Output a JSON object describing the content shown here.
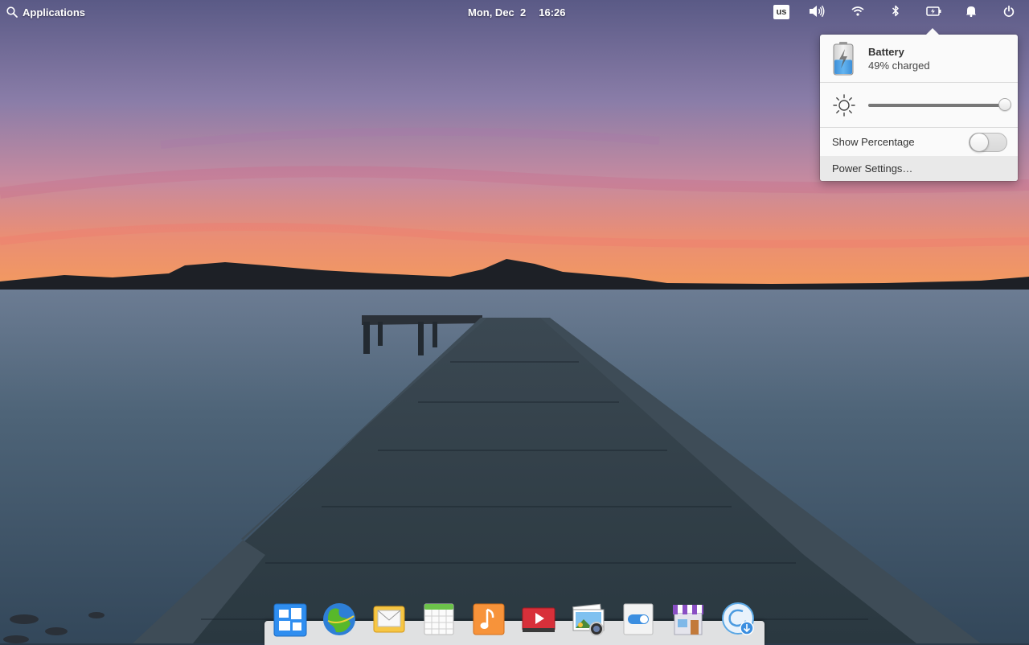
{
  "panel": {
    "applications_label": "Applications",
    "date": "Mon, Dec  2",
    "time": "16:26",
    "keyboard_layout": "us"
  },
  "power_popover": {
    "battery_title": "Battery",
    "battery_status": "49% charged",
    "battery_level": 0.49,
    "brightness_level": 1.0,
    "show_percentage_label": "Show Percentage",
    "show_percentage_enabled": false,
    "power_settings_label": "Power Settings…"
  },
  "dock": {
    "items": [
      {
        "name": "multitasking-view-icon"
      },
      {
        "name": "web-browser-icon"
      },
      {
        "name": "mail-icon"
      },
      {
        "name": "calendar-icon"
      },
      {
        "name": "music-icon"
      },
      {
        "name": "videos-icon"
      },
      {
        "name": "photos-icon"
      },
      {
        "name": "system-settings-icon"
      },
      {
        "name": "appcenter-icon"
      },
      {
        "name": "installer-icon"
      }
    ]
  }
}
